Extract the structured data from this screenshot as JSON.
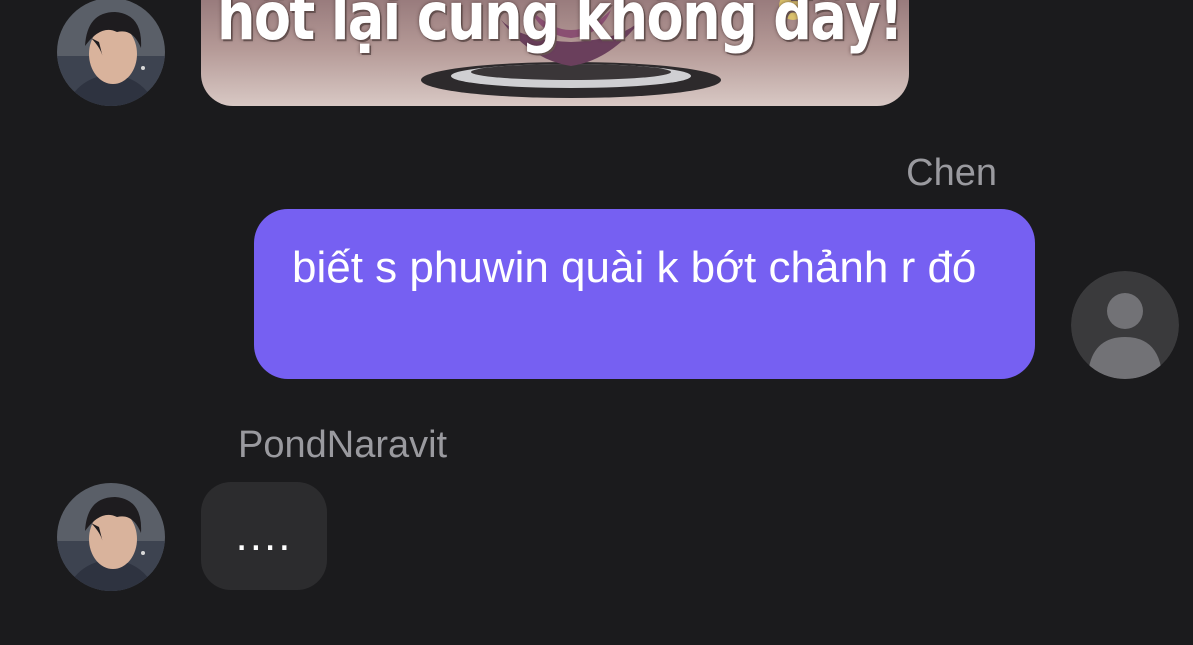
{
  "conversation": {
    "messages": [
      {
        "sender": "",
        "type": "image",
        "image_caption": "hốt lại cũng không đầy!"
      },
      {
        "sender": "Chen",
        "type": "text",
        "text": "biết s phuwin quài k bớt chảnh r đó"
      },
      {
        "sender": "PondNaravit",
        "type": "text",
        "text": "...."
      }
    ]
  },
  "colors": {
    "background": "#1b1b1d",
    "outgoing_bubble": "#7660f2",
    "incoming_bubble": "#2c2c2e",
    "sender_name": "#9a9a9f"
  },
  "icons": {
    "self_avatar": "default-person-avatar-icon",
    "contact_avatar": "profile-photo"
  }
}
